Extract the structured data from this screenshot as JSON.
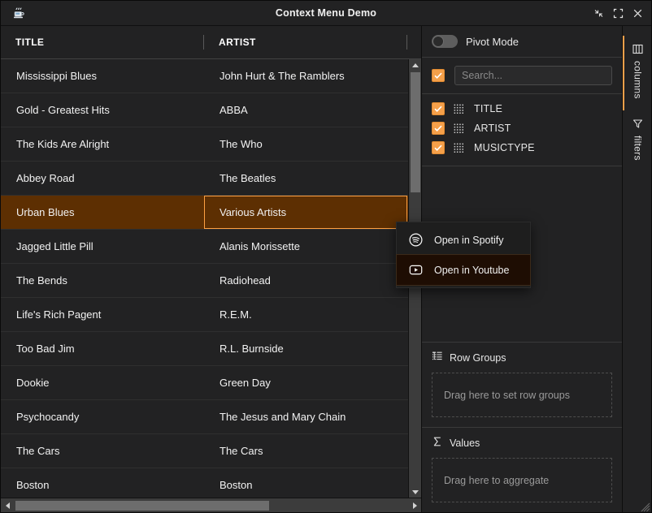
{
  "window": {
    "title": "Context Menu Demo",
    "app_icon": "java-coffee-cup-icon",
    "buttons": {
      "minimize": "minimize",
      "maximize": "maximize",
      "close": "close"
    }
  },
  "grid": {
    "columns": [
      {
        "id": "title",
        "label": "TITLE"
      },
      {
        "id": "artist",
        "label": "ARTIST"
      }
    ],
    "rows": [
      {
        "title": "Mississippi Blues",
        "artist": "John Hurt & The Ramblers",
        "selected": false
      },
      {
        "title": "Gold - Greatest Hits",
        "artist": "ABBA",
        "selected": false
      },
      {
        "title": "The Kids Are Alright",
        "artist": "The Who",
        "selected": false
      },
      {
        "title": "Abbey Road",
        "artist": "The Beatles",
        "selected": false
      },
      {
        "title": "Urban Blues",
        "artist": "Various Artists",
        "selected": true
      },
      {
        "title": "Jagged Little Pill",
        "artist": "Alanis Morissette",
        "selected": false
      },
      {
        "title": "The Bends",
        "artist": "Radiohead",
        "selected": false
      },
      {
        "title": "Life's Rich Pagent",
        "artist": "R.E.M.",
        "selected": false
      },
      {
        "title": "Too Bad Jim",
        "artist": "R.L. Burnside",
        "selected": false
      },
      {
        "title": "Dookie",
        "artist": "Green Day",
        "selected": false
      },
      {
        "title": "Psychocandy",
        "artist": "The Jesus and Mary Chain",
        "selected": false
      },
      {
        "title": "The Cars",
        "artist": "The Cars",
        "selected": false
      },
      {
        "title": "Boston",
        "artist": "Boston",
        "selected": false
      }
    ]
  },
  "context_menu": {
    "items": [
      {
        "label": "Open in Spotify",
        "icon": "spotify-icon",
        "highlighted": false
      },
      {
        "label": "Open in Youtube",
        "icon": "youtube-icon",
        "highlighted": true
      }
    ]
  },
  "tool_panel": {
    "pivot_mode": {
      "label": "Pivot Mode",
      "enabled": false
    },
    "search": {
      "placeholder": "Search...",
      "value": "",
      "select_all_checked": true
    },
    "columns": [
      {
        "label": "TITLE",
        "checked": true
      },
      {
        "label": "ARTIST",
        "checked": true
      },
      {
        "label": "MUSICTYPE",
        "checked": true
      }
    ],
    "row_groups": {
      "title": "Row Groups",
      "icon": "row-groups-icon",
      "drop_hint": "Drag here to set row groups"
    },
    "values": {
      "title": "Values",
      "icon": "sigma-icon",
      "drop_hint": "Drag here to aggregate"
    },
    "tabs": [
      {
        "label": "columns",
        "icon": "columns-icon",
        "active": true
      },
      {
        "label": "filters",
        "icon": "filter-funnel-icon",
        "active": false
      }
    ]
  },
  "colors": {
    "accent": "#f5a04a",
    "selection_bg": "#5d2f02",
    "focus_border": "#ffa143",
    "panel_bg": "#222223",
    "window_bg": "#1c1c1c"
  }
}
